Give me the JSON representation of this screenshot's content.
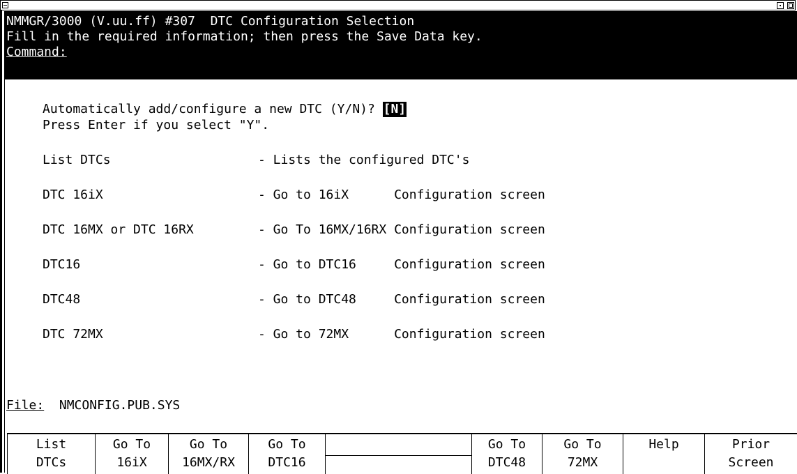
{
  "screen": {
    "title_line": "NMMGR/3000 (V.uu.ff) #307  DTC Configuration Selection",
    "instruction_line": "Fill in the required information; then press the Save Data key.",
    "command_label": "Command:",
    "command_value": ""
  },
  "auto_add": {
    "prompt": "Automatically add/configure a new DTC (Y/N)?",
    "value": "N",
    "note": "Press Enter if you select \"Y\"."
  },
  "menu": [
    {
      "label": "List DTCs",
      "desc": "- Lists the configured DTC's"
    },
    {
      "label": "DTC 16iX",
      "desc": "- Go to 16iX      Configuration screen"
    },
    {
      "label": "DTC 16MX or DTC 16RX",
      "desc": "- Go To 16MX/16RX Configuration screen"
    },
    {
      "label": "DTC16",
      "desc": "- Go to DTC16     Configuration screen"
    },
    {
      "label": "DTC48",
      "desc": "- Go to DTC48     Configuration screen"
    },
    {
      "label": "DTC 72MX",
      "desc": "- Go to 72MX      Configuration screen"
    }
  ],
  "file": {
    "label": "File:",
    "value": "NMCONFIG.PUB.SYS"
  },
  "softkeys": [
    {
      "line1": "List",
      "line2": "DTCs"
    },
    {
      "line1": "Go To",
      "line2": "16iX"
    },
    {
      "line1": "Go To",
      "line2": "16MX/RX"
    },
    {
      "line1": "Go To",
      "line2": "DTC16"
    },
    {
      "line1": "",
      "line2": ""
    },
    {
      "line1": "Go To",
      "line2": "DTC48"
    },
    {
      "line1": "Go To",
      "line2": "72MX"
    },
    {
      "line1": "Help",
      "line2": ""
    },
    {
      "line1": "Prior",
      "line2": "Screen"
    }
  ]
}
